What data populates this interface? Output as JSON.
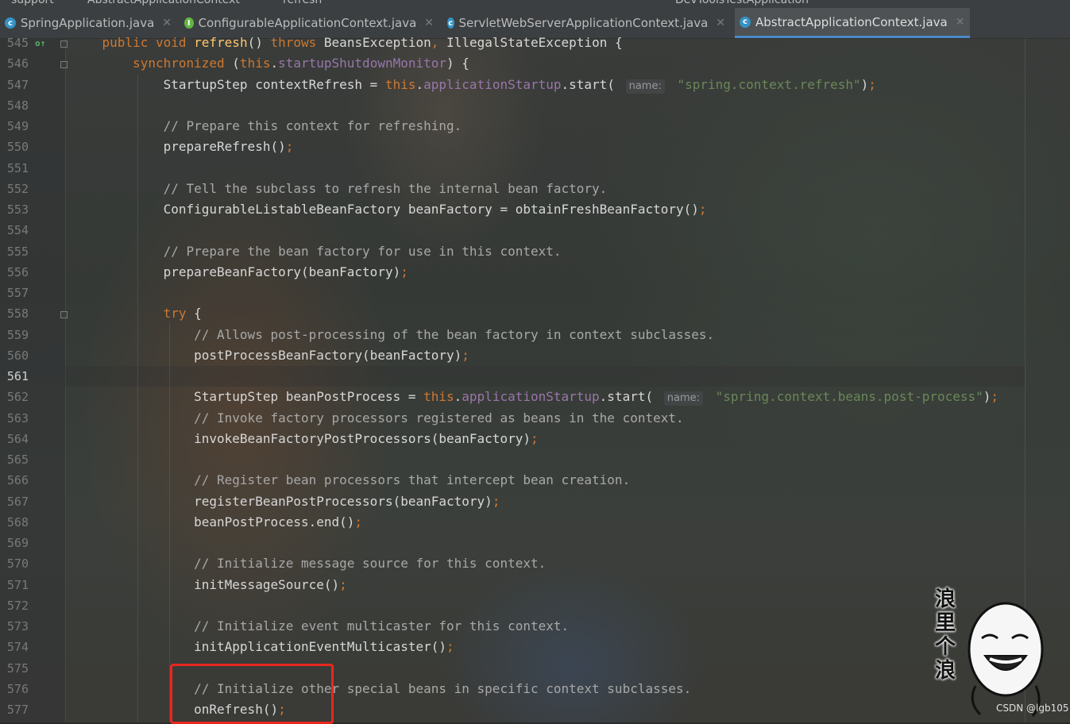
{
  "breadcrumb": [
    "support",
    "AbstractApplicationContext",
    "refresh"
  ],
  "run_config": "DevToolsTestApplication",
  "tabs": [
    {
      "label": "SpringApplication.java",
      "icon": "class-icon",
      "active": false
    },
    {
      "label": "ConfigurableApplicationContext.java",
      "icon": "interface-icon",
      "active": false
    },
    {
      "label": "ServletWebServerApplicationContext.java",
      "icon": "class-icon",
      "active": false
    },
    {
      "label": "AbstractApplicationContext.java",
      "icon": "class-icon",
      "active": true
    }
  ],
  "editor": {
    "current_line": "561",
    "lines": [
      {
        "n": "545",
        "t": "    public void refresh() throws BeansException, IllegalStateException {"
      },
      {
        "n": "546",
        "t": "        synchronized (this.startupShutdownMonitor) {"
      },
      {
        "n": "547",
        "t": "            StartupStep contextRefresh = this.applicationStartup.start( name: \"spring.context.refresh\");"
      },
      {
        "n": "548",
        "t": ""
      },
      {
        "n": "549",
        "t": "            // Prepare this context for refreshing."
      },
      {
        "n": "550",
        "t": "            prepareRefresh();"
      },
      {
        "n": "551",
        "t": ""
      },
      {
        "n": "552",
        "t": "            // Tell the subclass to refresh the internal bean factory."
      },
      {
        "n": "553",
        "t": "            ConfigurableListableBeanFactory beanFactory = obtainFreshBeanFactory();"
      },
      {
        "n": "554",
        "t": ""
      },
      {
        "n": "555",
        "t": "            // Prepare the bean factory for use in this context."
      },
      {
        "n": "556",
        "t": "            prepareBeanFactory(beanFactory);"
      },
      {
        "n": "557",
        "t": ""
      },
      {
        "n": "558",
        "t": "            try {"
      },
      {
        "n": "559",
        "t": "                // Allows post-processing of the bean factory in context subclasses."
      },
      {
        "n": "560",
        "t": "                postProcessBeanFactory(beanFactory);"
      },
      {
        "n": "561",
        "t": ""
      },
      {
        "n": "562",
        "t": "                StartupStep beanPostProcess = this.applicationStartup.start( name: \"spring.context.beans.post-process\");"
      },
      {
        "n": "563",
        "t": "                // Invoke factory processors registered as beans in the context."
      },
      {
        "n": "564",
        "t": "                invokeBeanFactoryPostProcessors(beanFactory);"
      },
      {
        "n": "565",
        "t": ""
      },
      {
        "n": "566",
        "t": "                // Register bean processors that intercept bean creation."
      },
      {
        "n": "567",
        "t": "                registerBeanPostProcessors(beanFactory);"
      },
      {
        "n": "568",
        "t": "                beanPostProcess.end();"
      },
      {
        "n": "569",
        "t": ""
      },
      {
        "n": "570",
        "t": "                // Initialize message source for this context."
      },
      {
        "n": "571",
        "t": "                initMessageSource();"
      },
      {
        "n": "572",
        "t": ""
      },
      {
        "n": "573",
        "t": "                // Initialize event multicaster for this context."
      },
      {
        "n": "574",
        "t": "                initApplicationEventMulticaster();"
      },
      {
        "n": "575",
        "t": ""
      },
      {
        "n": "576",
        "t": "                // Initialize other special beans in specific context subclasses."
      },
      {
        "n": "577",
        "t": "                onRefresh();"
      }
    ]
  },
  "sticker": {
    "text": "浪里个浪"
  },
  "watermark": "CSDN @lgb105",
  "colors": {
    "keyword": "#cc7832",
    "field": "#9876aa",
    "string": "#6a8759",
    "highlight_box": "#e8281e",
    "active_tab_underline": "#4a88c7"
  }
}
